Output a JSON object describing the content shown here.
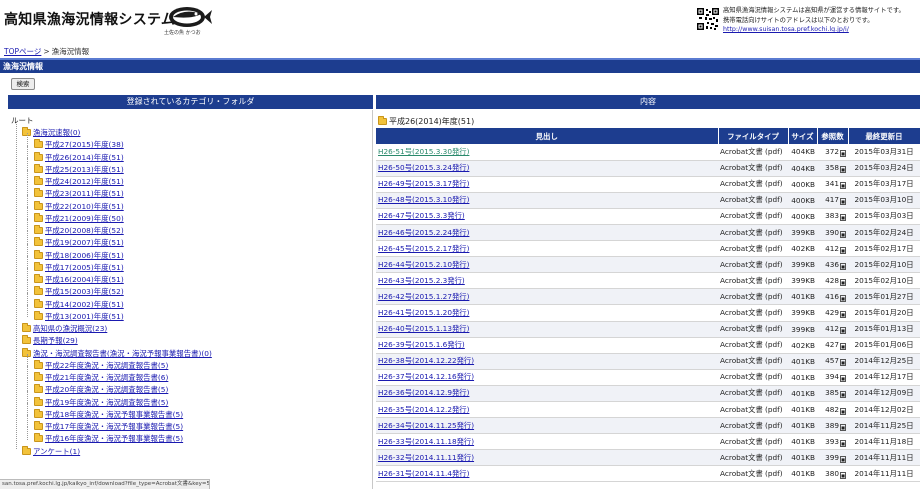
{
  "header": {
    "title": "高知県漁海況情報システム",
    "logo_caption": "土佐の魚 かつお",
    "note_line1": "高知県漁海況情報システムは高知県が運営する情報サイトです。",
    "note_line2": "携帯電話向けサイトのアドレスは以下のとおりです。",
    "mobile_url": "http://www.suisan.tosa.pref.kochi.lg.jp/i/"
  },
  "breadcrumb": {
    "top": "TOPページ",
    "sep": ">",
    "current": "漁海況情報"
  },
  "section_title": "漁海況情報",
  "search_button": "検索",
  "left": {
    "header": "登録されているカテゴリ・フォルダ",
    "root": "ルート",
    "tree": [
      {
        "label": "漁海況速報(0)",
        "level": 1
      },
      {
        "label": "平成27(2015)年度(38)",
        "level": 2
      },
      {
        "label": "平成26(2014)年度(51)",
        "level": 2
      },
      {
        "label": "平成25(2013)年度(51)",
        "level": 2
      },
      {
        "label": "平成24(2012)年度(51)",
        "level": 2
      },
      {
        "label": "平成23(2011)年度(51)",
        "level": 2
      },
      {
        "label": "平成22(2010)年度(51)",
        "level": 2
      },
      {
        "label": "平成21(2009)年度(50)",
        "level": 2
      },
      {
        "label": "平成20(2008)年度(52)",
        "level": 2
      },
      {
        "label": "平成19(2007)年度(51)",
        "level": 2
      },
      {
        "label": "平成18(2006)年度(51)",
        "level": 2
      },
      {
        "label": "平成17(2005)年度(51)",
        "level": 2
      },
      {
        "label": "平成16(2004)年度(51)",
        "level": 2
      },
      {
        "label": "平成15(2003)年度(52)",
        "level": 2
      },
      {
        "label": "平成14(2002)年度(51)",
        "level": 2
      },
      {
        "label": "平成13(2001)年度(51)",
        "level": 2
      },
      {
        "label": "高知県の漁況概況(23)",
        "level": 1
      },
      {
        "label": "長期予報(29)",
        "level": 1
      },
      {
        "label": "漁況・海況調査報告書(漁況・海況予報事業報告書)(0)",
        "level": 1
      },
      {
        "label": "平成22年度漁況・海況調査報告書(5)",
        "level": 2
      },
      {
        "label": "平成21年度漁況・海況調査報告書(6)",
        "level": 2
      },
      {
        "label": "平成20年度漁況・海況調査報告書(5)",
        "level": 2
      },
      {
        "label": "平成19年度漁況・海況調査報告書(5)",
        "level": 2
      },
      {
        "label": "平成18年度漁況・海況予報事業報告書(5)",
        "level": 2
      },
      {
        "label": "平成17年度漁況・海況予報事業報告書(5)",
        "level": 2
      },
      {
        "label": "平成16年度漁況・海況予報事業報告書(5)",
        "level": 2
      },
      {
        "label": "アンケート(1)",
        "level": 1
      }
    ]
  },
  "right": {
    "header": "内容",
    "folder_title": "平成26(2014)年度(51)",
    "columns": [
      "見出し",
      "ファイルタイプ",
      "サイズ",
      "参照数",
      "最終更新日"
    ],
    "rows": [
      [
        "H26-51号(2015.3.30発行)",
        "Acrobat文書 (pdf)",
        "404KB",
        "372",
        "2015年03月31日"
      ],
      [
        "H26-50号(2015.3.24発行)",
        "Acrobat文書 (pdf)",
        "404KB",
        "358",
        "2015年03月24日"
      ],
      [
        "H26-49号(2015.3.17発行)",
        "Acrobat文書 (pdf)",
        "400KB",
        "341",
        "2015年03月17日"
      ],
      [
        "H26-48号(2015.3.10発行)",
        "Acrobat文書 (pdf)",
        "400KB",
        "417",
        "2015年03月10日"
      ],
      [
        "H26-47号(2015.3.3発行)",
        "Acrobat文書 (pdf)",
        "400KB",
        "383",
        "2015年03月03日"
      ],
      [
        "H26-46号(2015.2.24発行)",
        "Acrobat文書 (pdf)",
        "399KB",
        "390",
        "2015年02月24日"
      ],
      [
        "H26-45号(2015.2.17発行)",
        "Acrobat文書 (pdf)",
        "402KB",
        "412",
        "2015年02月17日"
      ],
      [
        "H26-44号(2015.2.10発行)",
        "Acrobat文書 (pdf)",
        "399KB",
        "436",
        "2015年02月10日"
      ],
      [
        "H26-43号(2015.2.3発行)",
        "Acrobat文書 (pdf)",
        "399KB",
        "428",
        "2015年02月10日"
      ],
      [
        "H26-42号(2015.1.27発行)",
        "Acrobat文書 (pdf)",
        "401KB",
        "416",
        "2015年01月27日"
      ],
      [
        "H26-41号(2015.1.20発行)",
        "Acrobat文書 (pdf)",
        "399KB",
        "429",
        "2015年01月20日"
      ],
      [
        "H26-40号(2015.1.13発行)",
        "Acrobat文書 (pdf)",
        "399KB",
        "412",
        "2015年01月13日"
      ],
      [
        "H26-39号(2015.1.6発行)",
        "Acrobat文書 (pdf)",
        "402KB",
        "427",
        "2015年01月06日"
      ],
      [
        "H26-38号(2014.12.22発行)",
        "Acrobat文書 (pdf)",
        "401KB",
        "457",
        "2014年12月25日"
      ],
      [
        "H26-37号(2014.12.16発行)",
        "Acrobat文書 (pdf)",
        "401KB",
        "394",
        "2014年12月17日"
      ],
      [
        "H26-36号(2014.12.9発行)",
        "Acrobat文書 (pdf)",
        "401KB",
        "385",
        "2014年12月09日"
      ],
      [
        "H26-35号(2014.12.2発行)",
        "Acrobat文書 (pdf)",
        "401KB",
        "482",
        "2014年12月02日"
      ],
      [
        "H26-34号(2014.11.25発行)",
        "Acrobat文書 (pdf)",
        "401KB",
        "389",
        "2014年11月25日"
      ],
      [
        "H26-33号(2014.11.18発行)",
        "Acrobat文書 (pdf)",
        "401KB",
        "393",
        "2014年11月18日"
      ],
      [
        "H26-32号(2014.11.11発行)",
        "Acrobat文書 (pdf)",
        "401KB",
        "399",
        "2014年11月11日"
      ],
      [
        "H26-31号(2014.11.4発行)",
        "Acrobat文書 (pdf)",
        "401KB",
        "380",
        "2014年11月11日"
      ]
    ]
  },
  "status_url": "san.tosa.pref.kochi.lg.jp/kaikyo_inf/download?file_type=Acrobat文書&key=505",
  "icons": {
    "logo": "fish-logo-icon",
    "qr": "qr-code-icon",
    "folder": "folder-icon",
    "counter": "page-counter-icon"
  },
  "colors": {
    "nav_blue": "#1d3d8f",
    "link": "#1a1ab0",
    "visited_link": "#2a8a6c",
    "folder": "#f2c23a"
  }
}
